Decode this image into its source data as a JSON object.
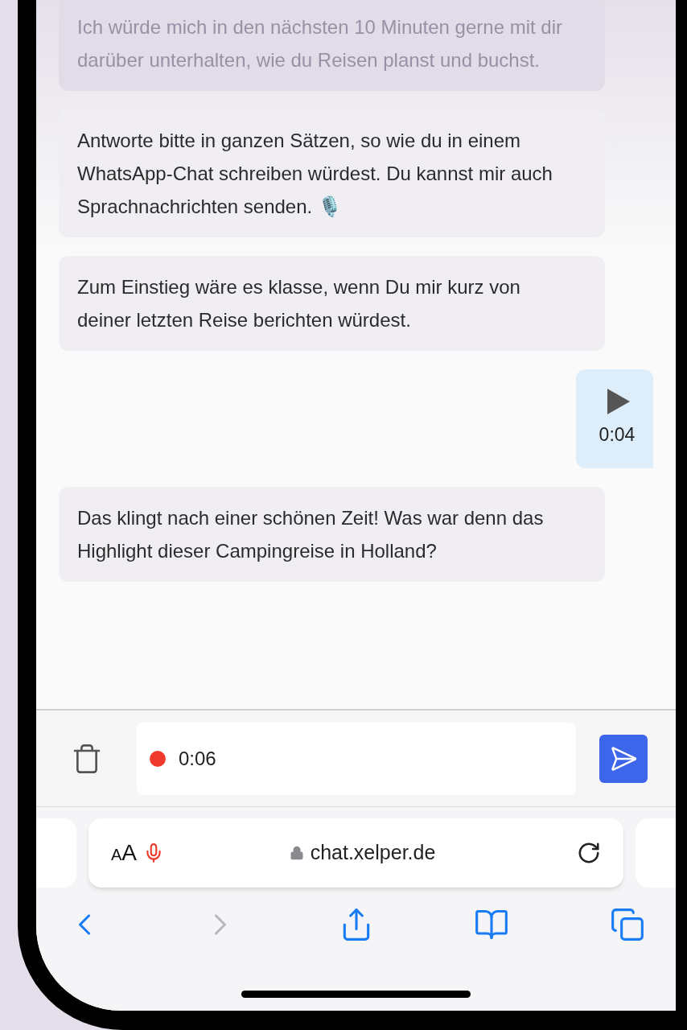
{
  "messages": [
    {
      "kind": "text",
      "faded": true,
      "text": "Ich würde mich in den nächsten 10 Minuten gerne mit dir darüber unterhalten, wie du Reisen planst und buchst."
    },
    {
      "kind": "text",
      "faded": false,
      "text": "Antworte bitte in ganzen Sätzen, so wie du in einem WhatsApp-Chat schreiben würdest. Du kannst mir auch Sprachnachrichten senden. 🎙️"
    },
    {
      "kind": "text",
      "faded": false,
      "text": "Zum Einstieg wäre es klasse, wenn Du mir kurz von deiner letzten Reise berichten würdest."
    },
    {
      "kind": "voice",
      "duration": "0:04"
    },
    {
      "kind": "text",
      "faded": false,
      "text": "Das klingt nach einer schönen Zeit! Was war denn das Highlight dieser Campingreise in Holland?"
    }
  ],
  "recorder": {
    "recording": true,
    "time": "0:06"
  },
  "browser": {
    "text_size": "AA",
    "url": "chat.xelper.de",
    "nav": [
      {
        "kind": "back",
        "disabled": false
      },
      {
        "kind": "forward",
        "disabled": true
      },
      {
        "kind": "share",
        "disabled": false
      },
      {
        "kind": "bookmarks",
        "disabled": false
      },
      {
        "kind": "tabs",
        "disabled": false
      }
    ]
  }
}
